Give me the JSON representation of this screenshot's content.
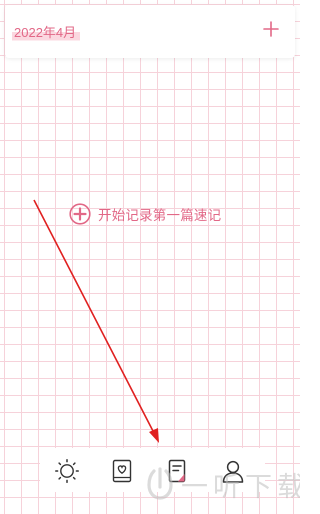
{
  "header": {
    "month": "2022年4月",
    "add_icon": "plus-icon"
  },
  "empty_state": {
    "cta_label": "开始记录第一篇速记",
    "icon": "plus-circle-icon"
  },
  "tab_bar": {
    "items": [
      {
        "icon": "sun-icon",
        "active": false
      },
      {
        "icon": "notebook-heart-icon",
        "active": false
      },
      {
        "icon": "quick-note-icon",
        "active": true
      },
      {
        "icon": "profile-icon",
        "active": false
      }
    ]
  },
  "watermark": {
    "text": "一听下载"
  },
  "colors": {
    "accent": "#e26887",
    "grid": "#f6d2da",
    "highlight": "#fbd8e0",
    "annotation": "#e02020",
    "icon_dark": "#333333"
  }
}
